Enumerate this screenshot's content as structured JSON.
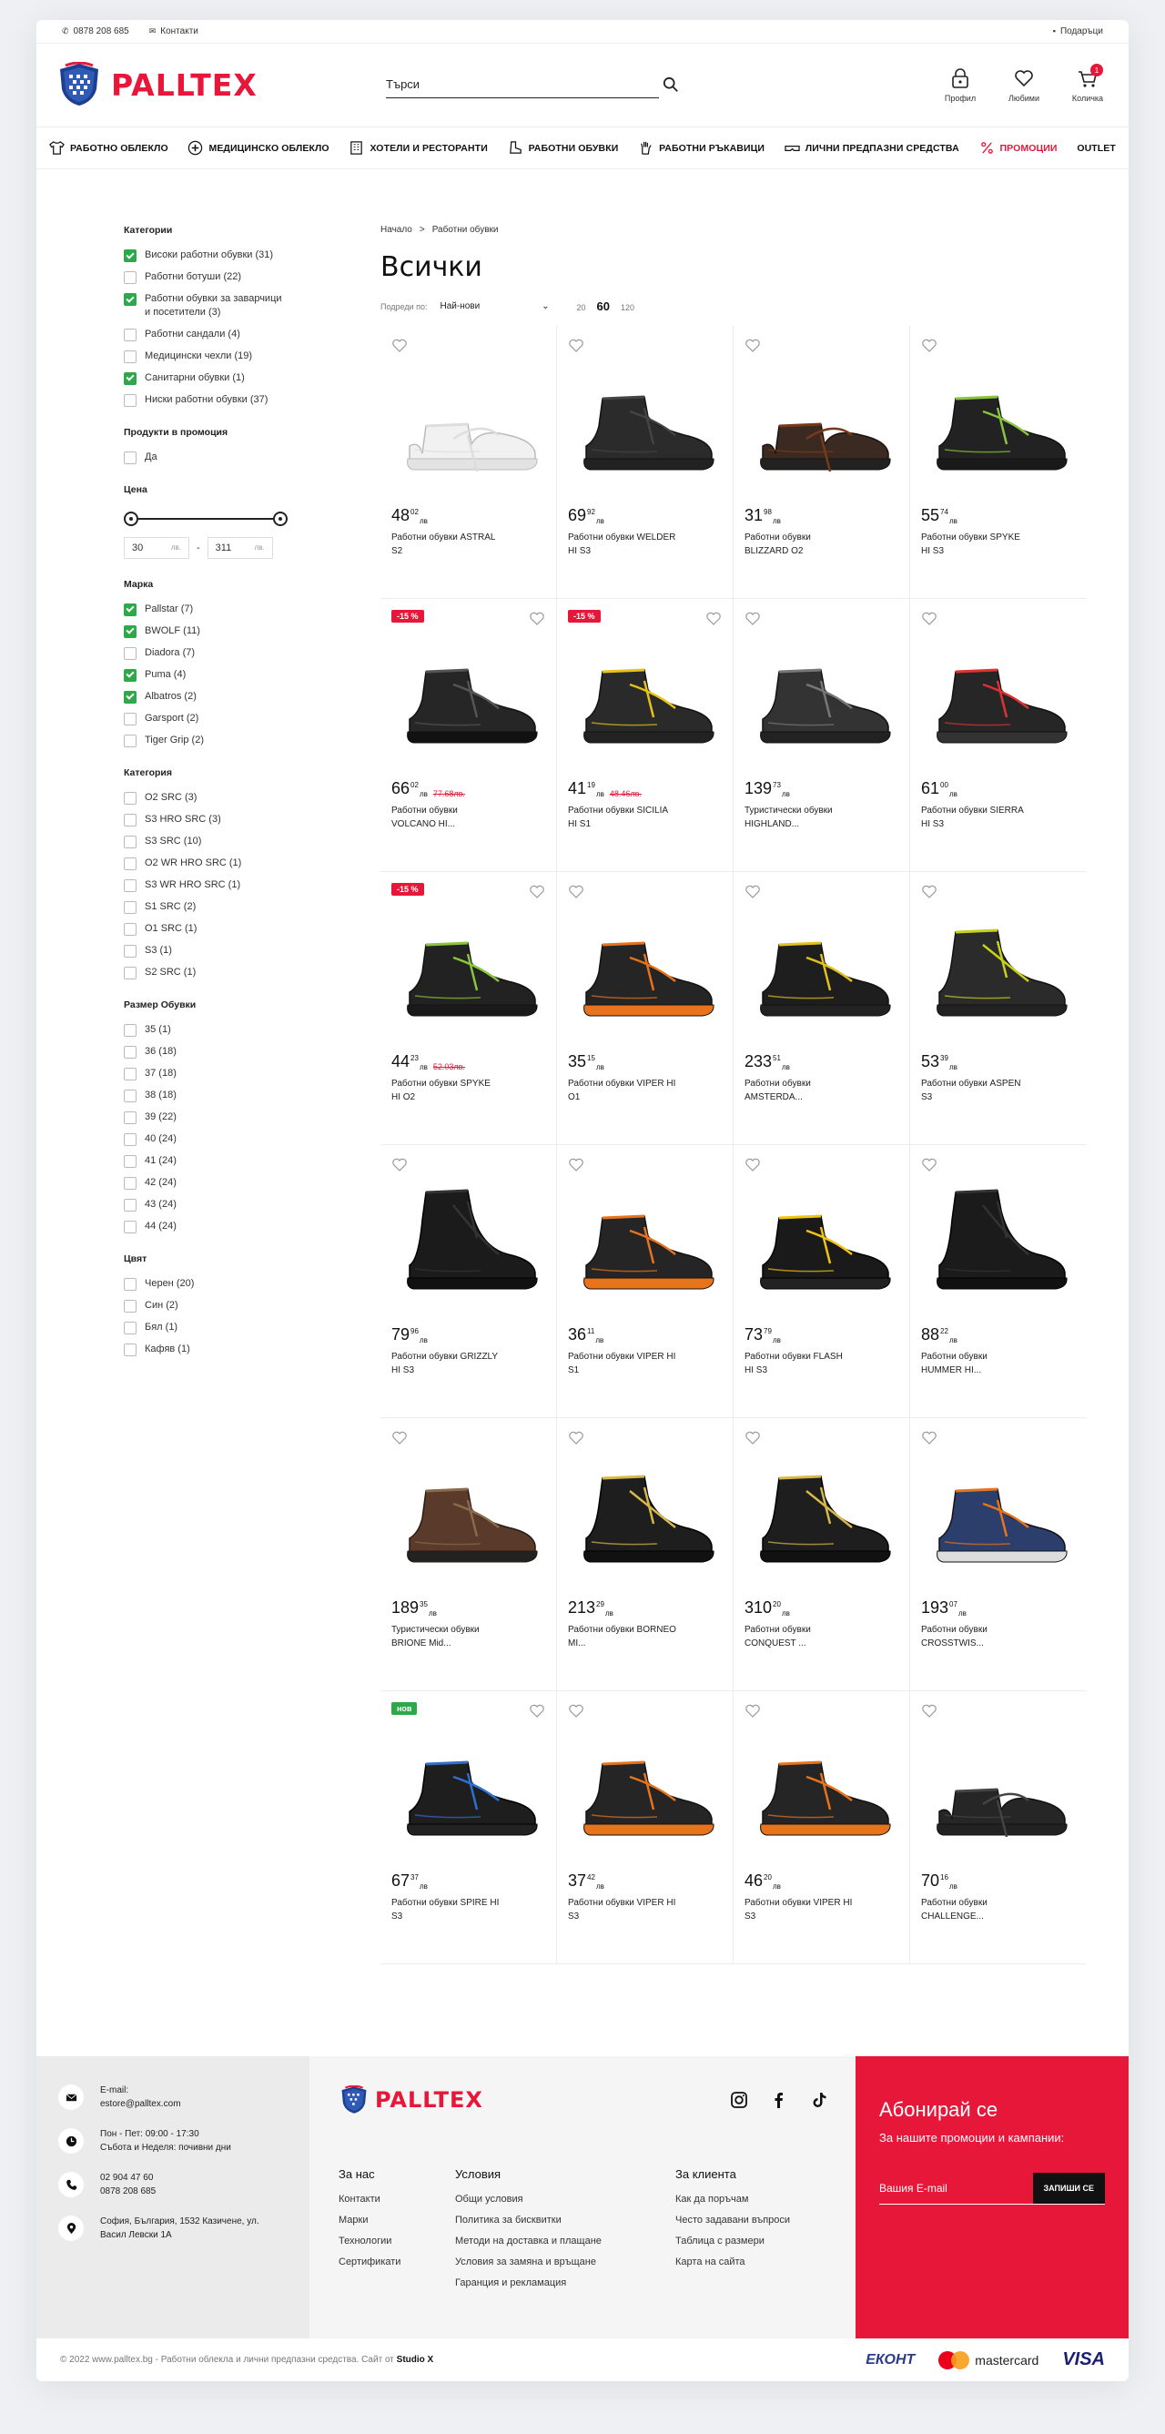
{
  "topbar": {
    "phone": "0878 208 685",
    "contacts": "Контакти",
    "gifts": "Подаръци"
  },
  "brand": {
    "name": "PALLTEX",
    "accent": "#e7173a"
  },
  "search": {
    "placeholder": "Търси"
  },
  "header_icons": [
    {
      "icon": "profile-icon",
      "label": "Профил"
    },
    {
      "icon": "heart-icon",
      "label": "Любими"
    },
    {
      "icon": "cart-icon",
      "label": "Количка",
      "badge": "1"
    }
  ],
  "nav": [
    {
      "icon": "shirt-icon",
      "label": "РАБОТНО ОБЛЕКЛО"
    },
    {
      "icon": "medical-icon",
      "label": "МЕДИЦИНСКО ОБЛЕКЛО"
    },
    {
      "icon": "hotel-icon",
      "label": "ХОТЕЛИ И РЕСТОРАНТИ"
    },
    {
      "icon": "boot-icon",
      "label": "РАБОТНИ ОБУВКИ"
    },
    {
      "icon": "glove-icon",
      "label": "РАБОТНИ РЪКАВИЦИ"
    },
    {
      "icon": "goggles-icon",
      "label": "ЛИЧНИ ПРЕДПАЗНИ СРЕДСТВА"
    },
    {
      "icon": "percent-icon",
      "label": "ПРОМОЦИИ",
      "promo": true
    },
    {
      "icon": "",
      "label": "OUTLET"
    }
  ],
  "filters": {
    "categories": {
      "title": "Категории",
      "items": [
        {
          "label": "Високи работни обувки (31)",
          "checked": true
        },
        {
          "label": "Работни ботуши (22)",
          "checked": false
        },
        {
          "label": "Работни обувки за заварчици и посетители (3)",
          "checked": true
        },
        {
          "label": "Работни сандали (4)",
          "checked": false
        },
        {
          "label": "Медицински чехли (19)",
          "checked": false
        },
        {
          "label": "Санитарни обувки (1)",
          "checked": true
        },
        {
          "label": "Ниски работни обувки (37)",
          "checked": false
        }
      ]
    },
    "promo": {
      "title": "Продукти в промоция",
      "items": [
        {
          "label": "Да",
          "checked": false
        }
      ]
    },
    "price": {
      "title": "Цена",
      "min": "30",
      "max": "311",
      "currency": "лв."
    },
    "brand": {
      "title": "Марка",
      "items": [
        {
          "label": "Pallstar (7)",
          "checked": true
        },
        {
          "label": "BWOLF (11)",
          "checked": true
        },
        {
          "label": "Diadora (7)",
          "checked": false
        },
        {
          "label": "Puma (4)",
          "checked": true
        },
        {
          "label": "Albatros (2)",
          "checked": true
        },
        {
          "label": "Garsport (2)",
          "checked": false
        },
        {
          "label": "Tiger Grip (2)",
          "checked": false
        }
      ]
    },
    "category2": {
      "title": "Категория",
      "items": [
        {
          "label": "O2 SRC (3)",
          "checked": false
        },
        {
          "label": "S3 HRO SRC (3)",
          "checked": false
        },
        {
          "label": "S3 SRC (10)",
          "checked": false
        },
        {
          "label": "O2 WR HRO SRC (1)",
          "checked": false
        },
        {
          "label": "S3 WR HRO SRC (1)",
          "checked": false
        },
        {
          "label": "S1 SRC (2)",
          "checked": false
        },
        {
          "label": "O1 SRC (1)",
          "checked": false
        },
        {
          "label": "S3 (1)",
          "checked": false
        },
        {
          "label": "S2 SRC (1)",
          "checked": false
        }
      ]
    },
    "size": {
      "title": "Размер Обувки",
      "items": [
        {
          "label": "35 (1)",
          "checked": false
        },
        {
          "label": "36 (18)",
          "checked": false
        },
        {
          "label": "37 (18)",
          "checked": false
        },
        {
          "label": "38 (18)",
          "checked": false
        },
        {
          "label": "39 (22)",
          "checked": false
        },
        {
          "label": "40 (24)",
          "checked": false
        },
        {
          "label": "41 (24)",
          "checked": false
        },
        {
          "label": "42 (24)",
          "checked": false
        },
        {
          "label": "43 (24)",
          "checked": false
        },
        {
          "label": "44 (24)",
          "checked": false
        }
      ]
    },
    "color": {
      "title": "Цвят",
      "items": [
        {
          "label": "Черен (20)",
          "checked": false
        },
        {
          "label": "Син (2)",
          "checked": false
        },
        {
          "label": "Бял (1)",
          "checked": false
        },
        {
          "label": "Кафяв (1)",
          "checked": false
        }
      ]
    }
  },
  "main": {
    "breadcrumb": [
      "Начало",
      ">",
      "Работни обувки"
    ],
    "title": "Всички",
    "sort_label": "Подреди по:",
    "sort_value": "Най-нови",
    "counts": [
      "20",
      "60",
      "120"
    ],
    "active_count": "60"
  },
  "products": [
    {
      "int": "48",
      "dec": "02",
      "name": "Работни обувки ASTRAL S2",
      "kind": "white-low",
      "heart": "left"
    },
    {
      "int": "69",
      "dec": "92",
      "name": "Работни обувки WELDER HI S3",
      "kind": "welder",
      "heart": "left"
    },
    {
      "int": "31",
      "dec": "98",
      "name": "Работни обувки BLIZZARD O2",
      "kind": "brown-low",
      "heart": "left"
    },
    {
      "int": "55",
      "dec": "74",
      "name": "Работни обувки SPYKE HI S3",
      "kind": "green-hi",
      "heart": "left"
    },
    {
      "int": "66",
      "dec": "02",
      "old": "77.68лв.",
      "tag": "-15 %",
      "name": "Работни обувки VOLCANO HI...",
      "kind": "black-hi",
      "heart": "right"
    },
    {
      "int": "41",
      "dec": "19",
      "old": "48.46лв.",
      "tag": "-15 %",
      "name": "Работни обувки SICILIA HI S1",
      "kind": "yellow-hi",
      "heart": "right"
    },
    {
      "int": "139",
      "dec": "73",
      "name": "Туристически обувки HIGHLAND...",
      "kind": "hiker",
      "heart": "left"
    },
    {
      "int": "61",
      "dec": "00",
      "name": "Работни обувки SIERRA HI S3",
      "kind": "red-hi",
      "heart": "left"
    },
    {
      "int": "44",
      "dec": "23",
      "old": "52.03лв.",
      "tag": "-15 %",
      "name": "Работни обувки SPYKE HI O2",
      "kind": "green-hi",
      "heart": "right"
    },
    {
      "int": "35",
      "dec": "15",
      "name": "Работни обувки VIPER HI O1",
      "kind": "orange-hi",
      "heart": "left"
    },
    {
      "int": "233",
      "dec": "51",
      "name": "Работни обувки AMSTERDA...",
      "kind": "puma-hi",
      "heart": "left"
    },
    {
      "int": "53",
      "dec": "39",
      "name": "Работни обувки ASPEN S3",
      "kind": "yellow-boot",
      "heart": "left"
    },
    {
      "int": "79",
      "dec": "96",
      "name": "Работни обувки GRIZZLY HI S3",
      "kind": "tall-boot",
      "heart": "left"
    },
    {
      "int": "36",
      "dec": "11",
      "name": "Работни обувки VIPER HI S1",
      "kind": "orange-hi",
      "heart": "left"
    },
    {
      "int": "73",
      "dec": "79",
      "name": "Работни обувки FLASH HI S3",
      "kind": "yellow-flash",
      "heart": "left"
    },
    {
      "int": "88",
      "dec": "22",
      "name": "Работни обувки HUMMER HI...",
      "kind": "tall-boot",
      "heart": "left"
    },
    {
      "int": "189",
      "dec": "35",
      "name": "Туристически обувки BRIONE Mid...",
      "kind": "brown-hiker",
      "heart": "left"
    },
    {
      "int": "213",
      "dec": "29",
      "name": "Работни обувки BORNEO MI...",
      "kind": "puma-black",
      "heart": "left"
    },
    {
      "int": "310",
      "dec": "20",
      "name": "Работни обувки CONQUEST ...",
      "kind": "puma-black",
      "heart": "left"
    },
    {
      "int": "193",
      "dec": "07",
      "name": "Работни обувки CROSSTWIS...",
      "kind": "blue-orange",
      "heart": "left"
    },
    {
      "int": "67",
      "dec": "37",
      "tag": "нов",
      "tagNew": true,
      "name": "Работни обувки SPIRE HI S3",
      "kind": "blue-hi",
      "heart": "right"
    },
    {
      "int": "37",
      "dec": "42",
      "name": "Работни обувки VIPER HI S3",
      "kind": "orange-hi",
      "heart": "left"
    },
    {
      "int": "46",
      "dec": "20",
      "name": "Работни обувки VIPER HI S3",
      "kind": "orange-hi",
      "heart": "left"
    },
    {
      "int": "70",
      "dec": "16",
      "name": "Работни обувки CHALLENGE...",
      "kind": "black-low",
      "heart": "left"
    }
  ],
  "currency": "лв",
  "footer": {
    "contacts": [
      {
        "icon": "mail-icon",
        "lines": [
          "E-mail:",
          "estore@palltex.com"
        ]
      },
      {
        "icon": "clock-icon",
        "lines": [
          "Пон - Пет: 09:00 - 17:30",
          "Събота и Неделя: почивни дни"
        ]
      },
      {
        "icon": "phone-icon",
        "lines": [
          "02 904 47 60",
          "0878 208 685"
        ]
      },
      {
        "icon": "pin-icon",
        "lines": [
          "София, България, 1532 Казичене, ул.",
          "Васил Левски 1А"
        ]
      }
    ],
    "columns": [
      {
        "title": "За нас",
        "links": [
          "Контакти",
          "Марки",
          "Технологии",
          "Сертификати"
        ]
      },
      {
        "title": "Условия",
        "links": [
          "Общи условия",
          "Политика за бисквитки",
          "Методи на доставка и плащане",
          "Условия за замяна и връщане",
          "Гаранция и рекламация"
        ]
      },
      {
        "title": "За клиента",
        "links": [
          "Как да поръчам",
          "Често задавани въпроси",
          "Таблица с размери",
          "Карта на сайта"
        ]
      }
    ],
    "subscribe": {
      "title": "Абонирай се",
      "subtitle": "За нашите промоции и кампании:",
      "placeholder": "Вашия E-mail",
      "button": "ЗАПИШИ СЕ"
    },
    "copyright": "© 2022 www.palltex.bg - Работни облекла и лични предпазни средства. Сайт от",
    "studio": "Studio X",
    "payments": [
      "ЕКОНТ",
      "mastercard",
      "VISA"
    ]
  }
}
